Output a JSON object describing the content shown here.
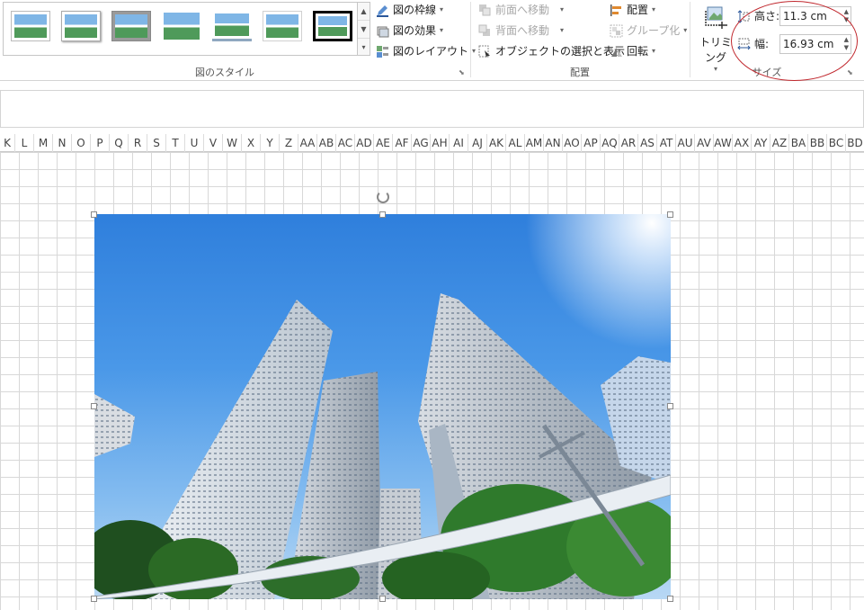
{
  "ribbon": {
    "picture_styles": {
      "label": "図のスタイル",
      "thumbnails": [
        "style-simple-frame",
        "style-soft-shadow",
        "style-gray-frame",
        "style-rounded",
        "style-reflected",
        "style-plain",
        "style-black-frame"
      ],
      "border_label": "図の枠線",
      "effects_label": "図の効果",
      "layout_label": "図のレイアウト"
    },
    "arrange": {
      "label": "配置",
      "bring_forward": "前面へ移動",
      "send_backward": "背面へ移動",
      "selection_pane": "オブジェクトの選択と表示",
      "align": "配置",
      "group": "グループ化",
      "rotate": "回転"
    },
    "size": {
      "label": "サイズ",
      "crop_label": "トリミング",
      "height_label": "高さ:",
      "height_value": "11.3 cm",
      "width_label": "幅:",
      "width_value": "16.93 cm"
    }
  },
  "columns": [
    "K",
    "L",
    "M",
    "N",
    "O",
    "P",
    "Q",
    "R",
    "S",
    "T",
    "U",
    "V",
    "W",
    "X",
    "Y",
    "Z",
    "AA",
    "AB",
    "AC",
    "AD",
    "AE",
    "AF",
    "AG",
    "AH",
    "AI",
    "AJ",
    "AK",
    "AL",
    "AM",
    "AN",
    "AO",
    "AP",
    "AQ",
    "AR",
    "AS",
    "AT",
    "AU",
    "AV",
    "AW",
    "AX",
    "AY",
    "AZ",
    "BA",
    "BB",
    "BC",
    "BD"
  ],
  "colors": {
    "highlight": "#c0272d",
    "sky": "#3b8ae0",
    "ribbon_border": "#d4d4d4"
  }
}
